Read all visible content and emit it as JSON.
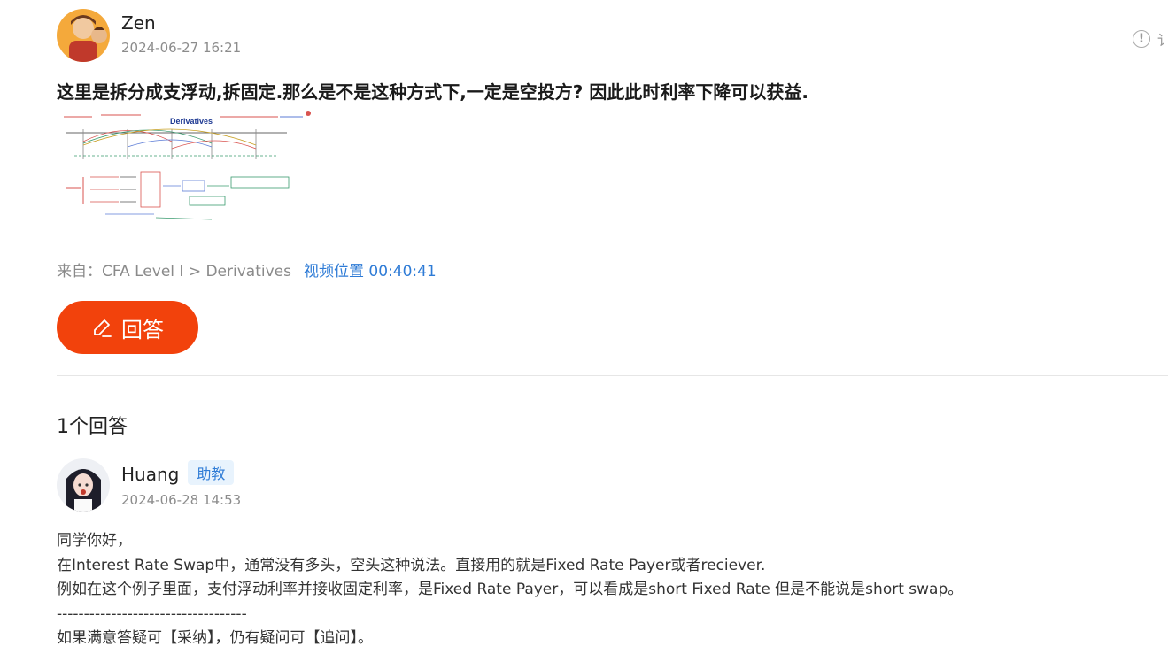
{
  "question": {
    "author": "Zen",
    "date": "2024-06-27 16:21",
    "report_label": "讠",
    "title": "这里是拆分成支浮动,拆固定.那么是不是这种方式下,一定是空投方? 因此此时利率下降可以获益.",
    "image_caption": "Derivatives",
    "source_label": "来自：CFA Level I > Derivatives",
    "video_position": "视频位置 00:40:41"
  },
  "answer_button": {
    "label": "回答"
  },
  "answers_section": {
    "count_label": "1个回答",
    "answers": [
      {
        "author": "Huang",
        "badge": "助教",
        "date": "2024-06-28 14:53",
        "lines": [
          "同学你好，",
          "在Interest Rate Swap中，通常没有多头，空头这种说法。直接用的就是Fixed Rate Payer或者reciever.",
          "例如在这个例子里面，支付浮动利率并接收固定利率，是Fixed Rate Payer，可以看成是short Fixed Rate 但是不能说是short swap。",
          "-----------------------------------",
          "如果满意答疑可【采纳】，仍有疑问可【追问】。"
        ]
      }
    ]
  },
  "colors": {
    "accent": "#f2420c",
    "link": "#2e7bd6",
    "badge_bg": "#e8f3fd"
  },
  "icons": [
    "avatar-zen",
    "info-icon",
    "pencil-icon",
    "avatar-huang"
  ]
}
